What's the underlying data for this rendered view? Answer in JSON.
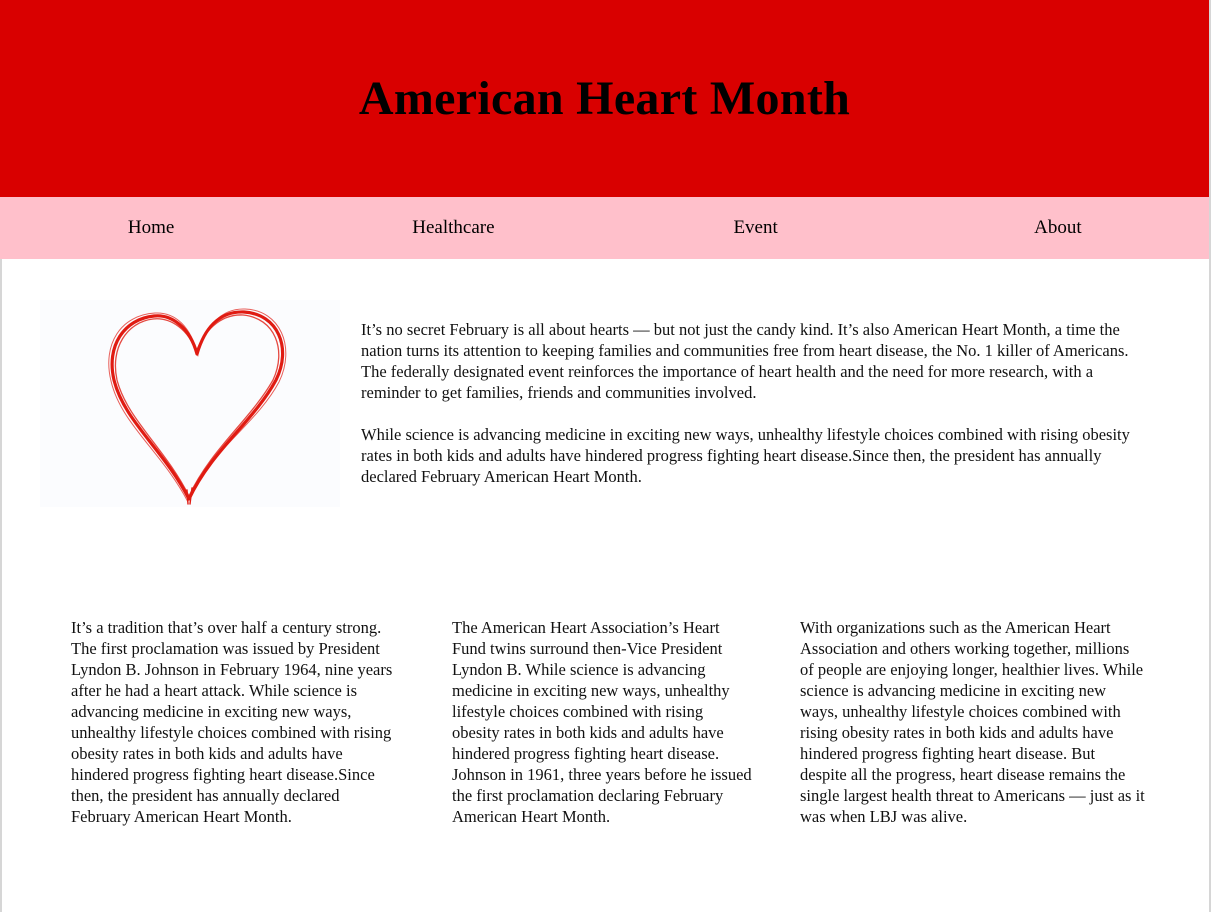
{
  "header": {
    "title": "American Heart Month"
  },
  "nav": {
    "items": [
      {
        "label": "Home"
      },
      {
        "label": "Healthcare"
      },
      {
        "label": "Event"
      },
      {
        "label": "About"
      }
    ]
  },
  "hero": {
    "image_icon": "heart-outline-icon",
    "heart_color": "#e01b12"
  },
  "intro": {
    "paragraphs": [
      "It’s no secret February is all about hearts — but not just the candy kind. It’s also American Heart Month, a time the nation turns its attention to keeping families and communities free from heart disease, the No. 1 killer of Americans. The federally designated event reinforces the importance of heart health and the need for more research, with a reminder to get families, friends and communities involved.",
      "While science is advancing medicine in exciting new ways, unhealthy lifestyle choices combined with rising obesity rates in both kids and adults have hindered progress fighting heart disease.Since then, the president has annually declared February American Heart Month."
    ]
  },
  "columns": [
    {
      "text": "It’s a tradition that’s over half a century strong. The first proclamation was issued by President Lyndon B. Johnson in February 1964, nine years after he had a heart attack. While science is advancing medicine in exciting new ways, unhealthy lifestyle choices combined with rising obesity rates in both kids and adults have hindered progress fighting heart disease.Since then, the president has annually declared February American Heart Month."
    },
    {
      "text": "The American Heart Association’s Heart Fund twins surround then-Vice President Lyndon B. While science is advancing medicine in exciting new ways, unhealthy lifestyle choices combined with rising obesity rates in both kids and adults have hindered progress fighting heart disease. Johnson in 1961, three years before he issued the first proclamation declaring February American Heart Month."
    },
    {
      "text": "With organizations such as the American Heart Association and others working together, millions of people are enjoying longer, healthier lives. While science is advancing medicine in exciting new ways, unhealthy lifestyle choices combined with rising obesity rates in both kids and adults have hindered progress fighting heart disease. But despite all the progress, heart disease remains the single largest health threat to Americans — just as it was when LBJ was alive."
    }
  ],
  "colors": {
    "banner": "#d90000",
    "nav_background": "#ffc0cb",
    "page_background": "#ffffff"
  }
}
